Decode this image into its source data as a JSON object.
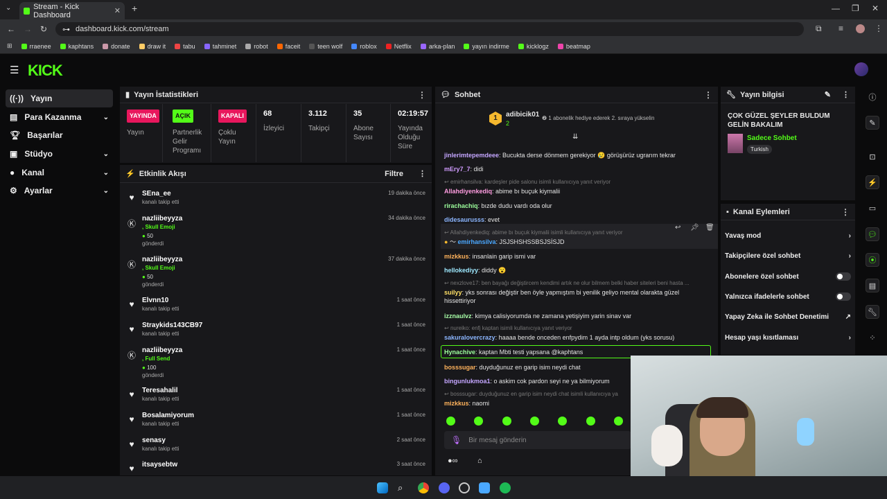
{
  "browser": {
    "tab_title": "Stream - Kick Dashboard",
    "url": "dashboard.kick.com/stream",
    "bookmarks": [
      "rraenee",
      "kaphtans",
      "donate",
      "draw it",
      "tabu",
      "tahminet",
      "robot",
      "faceit",
      "teen wolf",
      "roblox",
      "Netflix",
      "arka-plan",
      "yayın indirme",
      "kicklogz",
      "beatmap"
    ]
  },
  "sidebar": {
    "items": [
      {
        "label": "Yayın",
        "icon": "broadcast-icon"
      },
      {
        "label": "Para Kazanma",
        "icon": "money-icon"
      },
      {
        "label": "Başarılar",
        "icon": "trophy-icon"
      },
      {
        "label": "Stüdyo",
        "icon": "studio-icon"
      },
      {
        "label": "Kanal",
        "icon": "user-icon"
      },
      {
        "label": "Ayarlar",
        "icon": "gear-icon"
      }
    ]
  },
  "stats": {
    "title": "Yayın İstatistikleri",
    "items": [
      {
        "badge": "YAYINDA",
        "label": "Yayın",
        "color": "#e8175d"
      },
      {
        "badge": "AÇIK",
        "label": "Partnerlik Gelir Programı",
        "color": "#53fc18"
      },
      {
        "badge": "KAPALI",
        "label": "Çoklu Yayın",
        "color": "#e8175d"
      },
      {
        "value": "68",
        "label": "İzleyici"
      },
      {
        "value": "3.112",
        "label": "Takipçi"
      },
      {
        "value": "35",
        "label": "Abone Sayısı"
      },
      {
        "value": "02:19:57",
        "label": "Yayında Olduğu Süre"
      }
    ]
  },
  "activity": {
    "title": "Etkinlik Akışı",
    "filter": "Filtre",
    "events": [
      {
        "name": "SEna_ee",
        "sub": "kanalı takip etti",
        "time": "19 dakika önce",
        "type": "follow"
      },
      {
        "name": "nazliibeyyza",
        "extra": ", Skull Emoji",
        "amount": "50",
        "sub": "gönderdi",
        "time": "34 dakika önce",
        "type": "gift"
      },
      {
        "name": "nazliibeyyza",
        "extra": ", Skull Emoji",
        "amount": "50",
        "sub": "gönderdi",
        "time": "37 dakika önce",
        "type": "gift"
      },
      {
        "name": "Elvnn10",
        "sub": "kanalı takip etti",
        "time": "1 saat önce",
        "type": "follow"
      },
      {
        "name": "Straykids143CB97",
        "sub": "kanalı takip etti",
        "time": "1 saat önce",
        "type": "follow"
      },
      {
        "name": "nazliibeyyza",
        "extra": ", Full Send",
        "amount": "100",
        "sub": "gönderdi",
        "time": "1 saat önce",
        "type": "gift"
      },
      {
        "name": "Teresahalil",
        "sub": "kanalı takip etti",
        "time": "1 saat önce",
        "type": "follow"
      },
      {
        "name": "Bosalamiyorum",
        "sub": "kanalı takip etti",
        "time": "1 saat önce",
        "type": "follow"
      },
      {
        "name": "senasy",
        "sub": "kanalı takip etti",
        "time": "2 saat önce",
        "type": "follow"
      },
      {
        "name": "itsaysebtw",
        "sub": "",
        "time": "3 saat önce",
        "type": "follow"
      }
    ]
  },
  "chat": {
    "title": "Sohbet",
    "top_user": "adibicik01",
    "top_count": "2",
    "gift_text": "1 abonelik hediye ederek 2. sıraya yükselin",
    "messages": [
      {
        "user": "jinlerimtepemdeee",
        "color": "#c4a6ff",
        "text": "Bucukta derse dönmem gerekiyor 😢 görüşürüz ugrarım tekrar"
      },
      {
        "user": "mEry7_7",
        "color": "#d19cff",
        "text": "didi"
      },
      {
        "reply": "emirhansilva: kardeşler pide salonu isimli kullanıcıya yanıt veriyor"
      },
      {
        "user": "Allahdiyenkediq",
        "color": "#ff9de1",
        "text": "abime bı buçuk kiymalii"
      },
      {
        "user": "rirachachiq",
        "color": "#9dff9d",
        "text": "bızde dudu vardı oda olur"
      },
      {
        "user": "didesaurusss",
        "color": "#8cb6ff",
        "text": "evet"
      },
      {
        "reply": "Allahdiyenkediq: abime bı buçuk kiymalii isimli kullanıcıya yanıt veriyor"
      },
      {
        "user": "emirhansilva",
        "color": "#4aa8ff",
        "text": "JSJSHSHSSBSJSİSJD"
      },
      {
        "user": "mizkkus",
        "color": "#ffb35c",
        "text": "insanlain garip ismi var"
      },
      {
        "user": "hellokediyy",
        "color": "#9ee9ff",
        "text": "diddy 😮"
      },
      {
        "reply": "nexzlove17: ben bayağı değiştircem kendimi artık ne olur bilmem belki haber siteleri beni hasta ..."
      },
      {
        "user": "suilyy",
        "color": "#ffe066",
        "text": "yks sonrası değiştir ben öyle yapmıştım bi yenilik geliyo mental olarakta güzel hissettiriyor"
      },
      {
        "user": "izznaulvz",
        "color": "#a8ffa8",
        "text": "kimya calisiyorumda ne zamana yetişiyim yarin sinav var"
      },
      {
        "reply": "nureiko: enfj kaptan isimli kullanıcıya yanıt veriyor"
      },
      {
        "user": "sakuralovercrazy",
        "color": "#8cb6ff",
        "text": "haaaa bende onceden enfpydim 1 ayda intp oldum (yks sorusu)"
      },
      {
        "user": "Hynachive",
        "color": "#9dff9d",
        "text": "kaptan Mbti testi yapsana @kaphtans"
      },
      {
        "user": "bosssugar",
        "color": "#ffb35c",
        "text": "duyduğunuz en garip isim neydi chat"
      },
      {
        "user": "bingunlukmoa1",
        "color": "#c4a6ff",
        "text": "o askim cok pardon seyi ne ya bilmiyorum"
      },
      {
        "reply": "bosssugar: duyduğunuz en garip isim neydi chat isimli kullanıcıya ya"
      },
      {
        "user": "mizkkus",
        "color": "#ffb35c",
        "text": "naomi"
      }
    ],
    "input_placeholder": "Bir mesaj gönderin"
  },
  "stream_info": {
    "title": "Yayın bilgisi",
    "stream_title": "ÇOK GÜZEL ŞEYLER BULDUM GELİN BAKALIM",
    "category": "Sadece Sohbet",
    "tag": "Turkish"
  },
  "channel_actions": {
    "title": "Kanal Eylemleri",
    "items": [
      {
        "label": "Yavaş mod",
        "kind": "chevron"
      },
      {
        "label": "Takipçilere özel sohbet",
        "kind": "chevron"
      },
      {
        "label": "Abonelere özel sohbet",
        "kind": "toggle"
      },
      {
        "label": "Yalnızca ifadelerle sohbet",
        "kind": "toggle"
      },
      {
        "label": "Yapay Zeka ile Sohbet Denetimi",
        "kind": "external"
      },
      {
        "label": "Hesap yaşı kısıtlaması",
        "kind": "chevron"
      }
    ]
  },
  "colors": {
    "accent": "#53fc18",
    "live": "#e8175d",
    "bg": "#0b0b0c",
    "panel": "#18181b"
  }
}
